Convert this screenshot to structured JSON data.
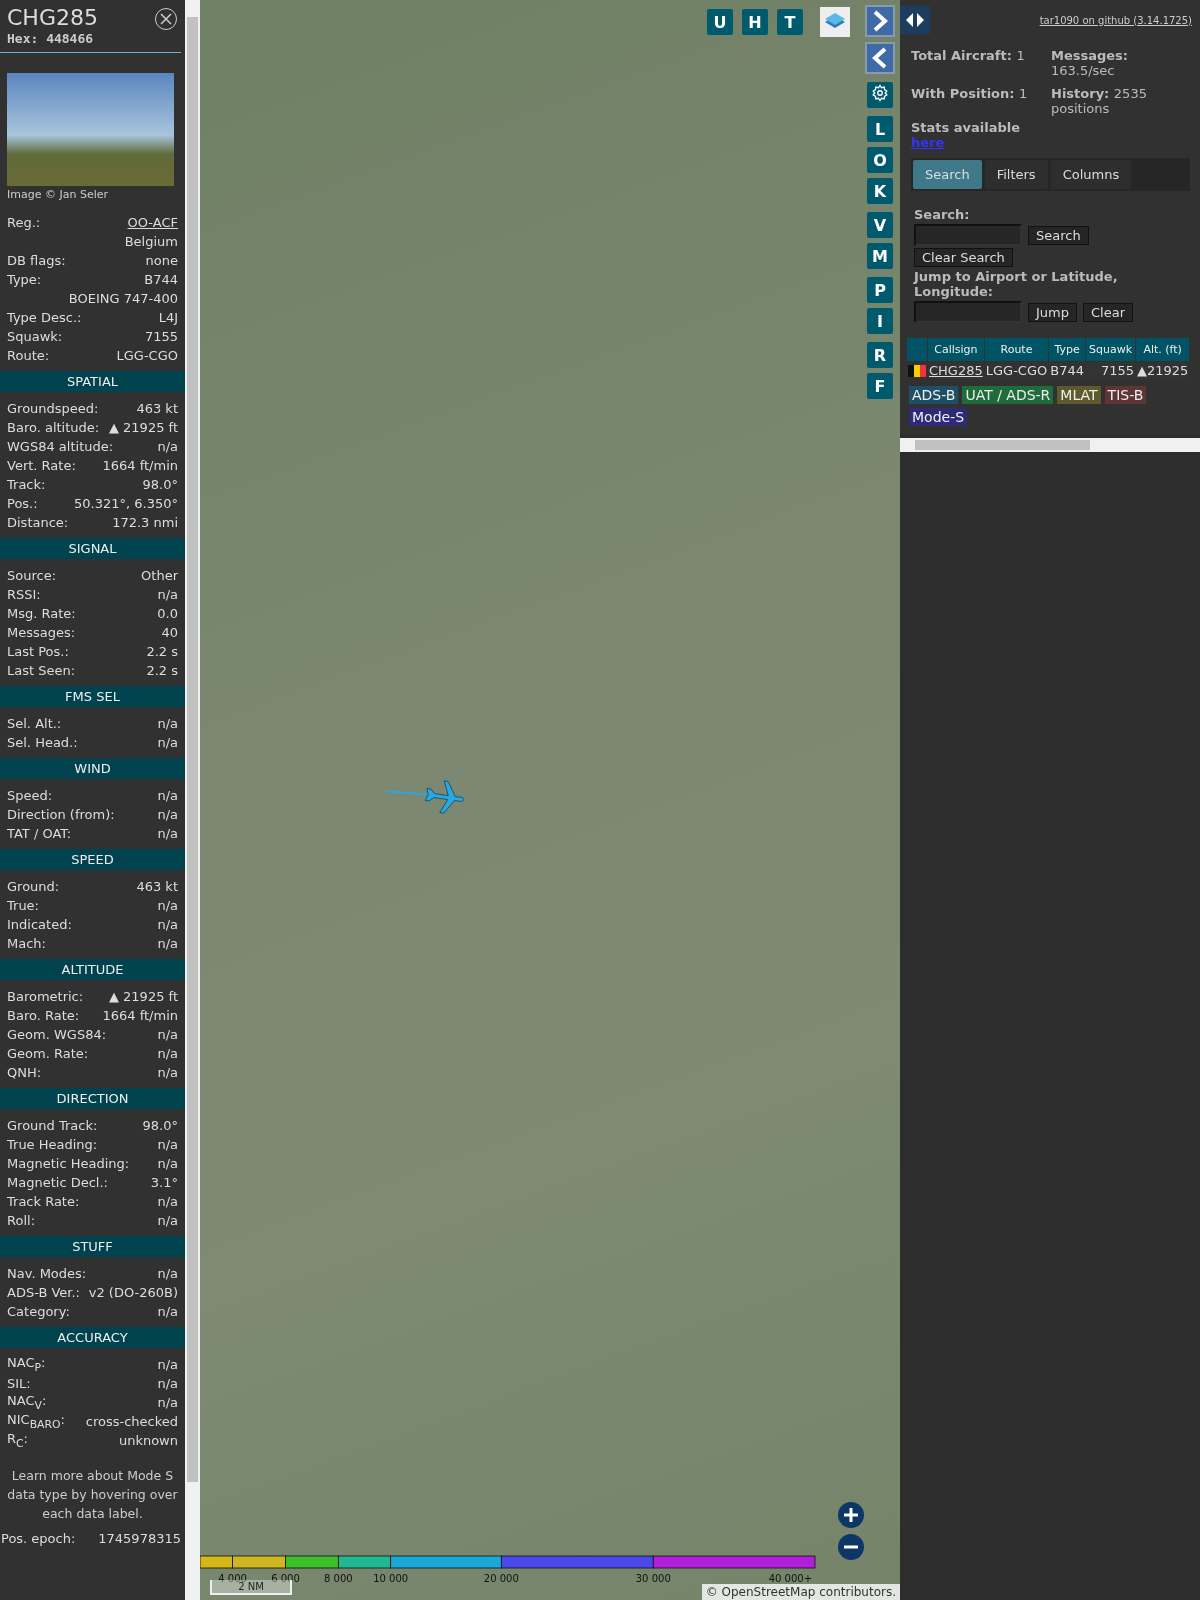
{
  "detail": {
    "callsign": "CHG285",
    "hex_label": "Hex:",
    "hex": "448466",
    "photo_credit": "Image © Jan Seler",
    "rows": [
      {
        "kind": "link",
        "label": "Reg.:",
        "value": "OO-ACF"
      },
      {
        "kind": "extra",
        "value": "Belgium"
      },
      {
        "kind": "pair",
        "label": "DB flags:",
        "value": "none"
      },
      {
        "kind": "pair",
        "label": "Type:",
        "value": "B744"
      },
      {
        "kind": "extra",
        "value": "BOEING 747-400"
      },
      {
        "kind": "pair",
        "label": "Type Desc.:",
        "value": "L4J"
      },
      {
        "kind": "pair",
        "label": "Squawk:",
        "value": "7155"
      },
      {
        "kind": "pair",
        "label": "Route:",
        "value": "LGG-CGO"
      }
    ],
    "sections": [
      {
        "title": "SPATIAL",
        "rows": [
          {
            "label": "Groundspeed:",
            "value": "463 kt"
          },
          {
            "label": "Baro. altitude:",
            "value": "▲ 21925 ft"
          },
          {
            "label": "WGS84 altitude:",
            "value": "n/a"
          },
          {
            "label": "Vert. Rate:",
            "value": "1664 ft/min"
          },
          {
            "label": "Track:",
            "value": "98.0°"
          },
          {
            "label": "Pos.:",
            "value": "50.321°, 6.350°"
          },
          {
            "label": "Distance:",
            "value": "172.3 nmi"
          }
        ]
      },
      {
        "title": "SIGNAL",
        "rows": [
          {
            "label": "Source:",
            "value": "Other"
          },
          {
            "label": "RSSI:",
            "value": "n/a"
          },
          {
            "label": "Msg. Rate:",
            "value": "0.0"
          },
          {
            "label": "Messages:",
            "value": "40"
          },
          {
            "label": "Last Pos.:",
            "value": "2.2 s"
          },
          {
            "label": "Last Seen:",
            "value": "2.2 s"
          }
        ]
      },
      {
        "title": "FMS SEL",
        "rows": [
          {
            "label": "Sel. Alt.:",
            "value": "n/a"
          },
          {
            "label": "Sel. Head.:",
            "value": "n/a"
          }
        ]
      },
      {
        "title": "WIND",
        "rows": [
          {
            "label": "Speed:",
            "value": "n/a"
          },
          {
            "label": "Direction (from):",
            "value": "n/a"
          },
          {
            "label": "TAT / OAT:",
            "value": "n/a"
          }
        ]
      },
      {
        "title": "SPEED",
        "rows": [
          {
            "label": "Ground:",
            "value": "463 kt"
          },
          {
            "label": "True:",
            "value": "n/a"
          },
          {
            "label": "Indicated:",
            "value": "n/a"
          },
          {
            "label": "Mach:",
            "value": "n/a"
          }
        ]
      },
      {
        "title": "ALTITUDE",
        "rows": [
          {
            "label": "Barometric:",
            "value": "▲ 21925 ft"
          },
          {
            "label": "Baro. Rate:",
            "value": "1664 ft/min"
          },
          {
            "label": "Geom. WGS84:",
            "value": "n/a"
          },
          {
            "label": "Geom. Rate:",
            "value": "n/a"
          },
          {
            "label": "QNH:",
            "value": "n/a"
          }
        ]
      },
      {
        "title": "DIRECTION",
        "rows": [
          {
            "label": "Ground Track:",
            "value": "98.0°"
          },
          {
            "label": "True Heading:",
            "value": "n/a"
          },
          {
            "label": "Magnetic Heading:",
            "value": "n/a"
          },
          {
            "label": "Magnetic Decl.:",
            "value": "3.1°"
          },
          {
            "label": "Track Rate:",
            "value": "n/a"
          },
          {
            "label": "Roll:",
            "value": "n/a"
          }
        ]
      },
      {
        "title": "STUFF",
        "rows": [
          {
            "label": "Nav. Modes:",
            "value": "n/a"
          },
          {
            "label": "ADS-B Ver.:",
            "value": "v2 (DO-260B)"
          },
          {
            "label": "Category:",
            "value": "n/a"
          }
        ]
      },
      {
        "title": "ACCURACY",
        "rows": [
          {
            "label": "NAC$_{P}$:",
            "value": "n/a"
          },
          {
            "label": "SIL:",
            "value": "n/a"
          },
          {
            "label": "NAC$_{V}$:",
            "value": "n/a"
          },
          {
            "label": "NIC$_{BARO}$:",
            "value": "cross-checked"
          },
          {
            "label": "R$_{C}$:",
            "value": "unknown"
          }
        ]
      }
    ],
    "note": "Learn more about Mode S data type by hovering over each data label.",
    "footer": {
      "label": "Pos. epoch:",
      "value": "1745978315"
    }
  },
  "map": {
    "top_buttons": [
      "U",
      "H",
      "T"
    ],
    "side_groups": [
      [
        "L",
        "O",
        "K"
      ],
      [
        "V",
        "M"
      ],
      [
        "P",
        "I"
      ],
      [
        "R",
        "F"
      ]
    ],
    "legend_ticks": [
      "4 000",
      "6 000",
      "8 000",
      "10 000",
      "20 000",
      "30 000",
      "40 000+"
    ],
    "scale": "2 NM",
    "attribution_prefix": "© ",
    "attribution_link": "OpenStreetMap",
    "attribution_suffix": " contributors."
  },
  "panel": {
    "github_link": "tar1090 on github (3.14.1725)",
    "stats": [
      {
        "label": "Total Aircraft:",
        "value": "1"
      },
      {
        "label": "Messages:",
        "value": "163.5/sec"
      },
      {
        "label": "With Position:",
        "value": "1"
      },
      {
        "label": "History:",
        "value": "2535 positions"
      }
    ],
    "stats_text": "Stats available",
    "stats_link": "here",
    "tabs": [
      {
        "label": "Search",
        "selected": true
      },
      {
        "label": "Filters",
        "selected": false
      },
      {
        "label": "Columns",
        "selected": false
      }
    ],
    "search_label": "Search:",
    "search_button": "Search",
    "clear_search_button": "Clear Search",
    "jump_label": "Jump to Airport or Latitude, Longitude:",
    "jump_button": "Jump",
    "clear_button": "Clear",
    "columns": [
      "Callsign",
      "Route",
      "Type",
      "Squawk",
      "Alt. (ft)"
    ],
    "rows": [
      {
        "callsign": "CHG285",
        "route": "LGG-CGO",
        "type": "B744",
        "squawk": "7155",
        "altitude": "▲21925"
      }
    ],
    "sources": [
      {
        "label": "ADS-B",
        "color": "#1f4f66"
      },
      {
        "label": "UAT / ADS-R",
        "color": "#1f6b3a"
      },
      {
        "label": "MLAT",
        "color": "#5f5a2e"
      },
      {
        "label": "TIS-B",
        "color": "#5e3434"
      },
      {
        "label": "Mode-S",
        "color": "#2e2a78"
      }
    ]
  }
}
